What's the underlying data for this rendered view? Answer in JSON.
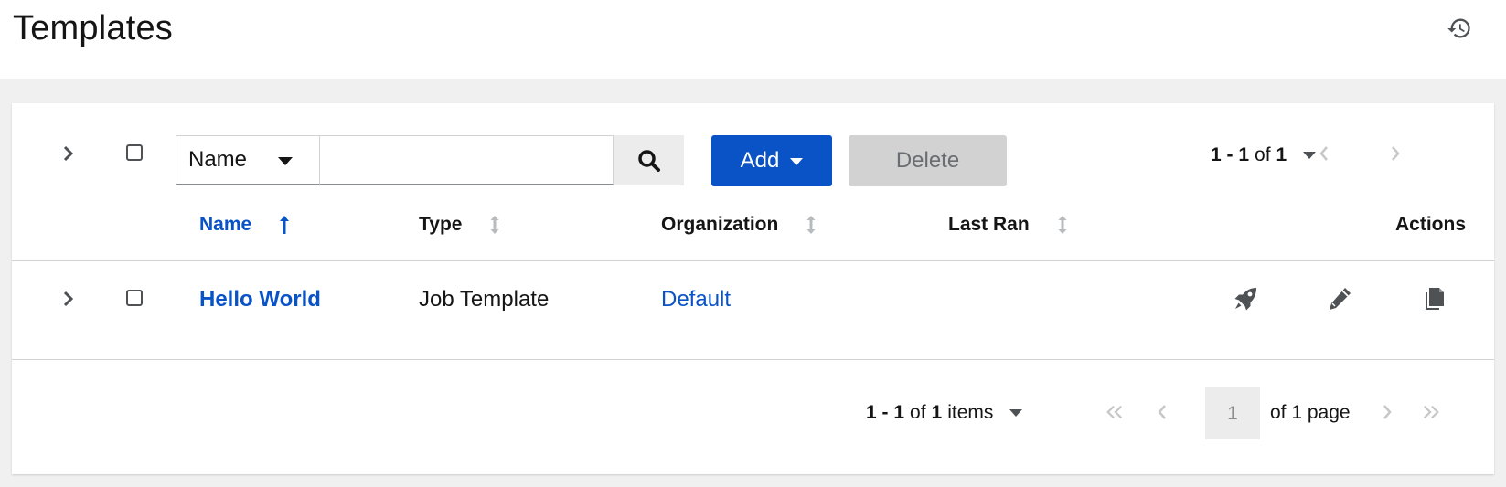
{
  "header": {
    "title": "Templates",
    "history_icon": "history-icon"
  },
  "toolbar": {
    "filter_select": "Name",
    "search_placeholder": "",
    "add_label": "Add",
    "delete_label": "Delete",
    "pagination": {
      "range": "1 - 1",
      "of": "of",
      "total": "1"
    }
  },
  "table": {
    "columns": [
      {
        "label": "Name",
        "sort": "ascending"
      },
      {
        "label": "Type",
        "sort": "none"
      },
      {
        "label": "Organization",
        "sort": "none"
      },
      {
        "label": "Last Ran",
        "sort": "none"
      },
      {
        "label": "Actions"
      }
    ],
    "rows": [
      {
        "name": "Hello World",
        "type": "Job Template",
        "organization": "Default",
        "last_ran": "",
        "actions": [
          "rocket-icon",
          "pencil-icon",
          "copy-icon"
        ]
      }
    ]
  },
  "footer": {
    "range": "1 - 1",
    "of": "of",
    "total": "1",
    "items_label": "items",
    "page_value": "1",
    "page_placeholder": "1",
    "of_pages": "of 1 page"
  },
  "colors": {
    "primary": "#0a53c6",
    "disabled": "#d2d2d2",
    "background": "#f0f0f0"
  }
}
